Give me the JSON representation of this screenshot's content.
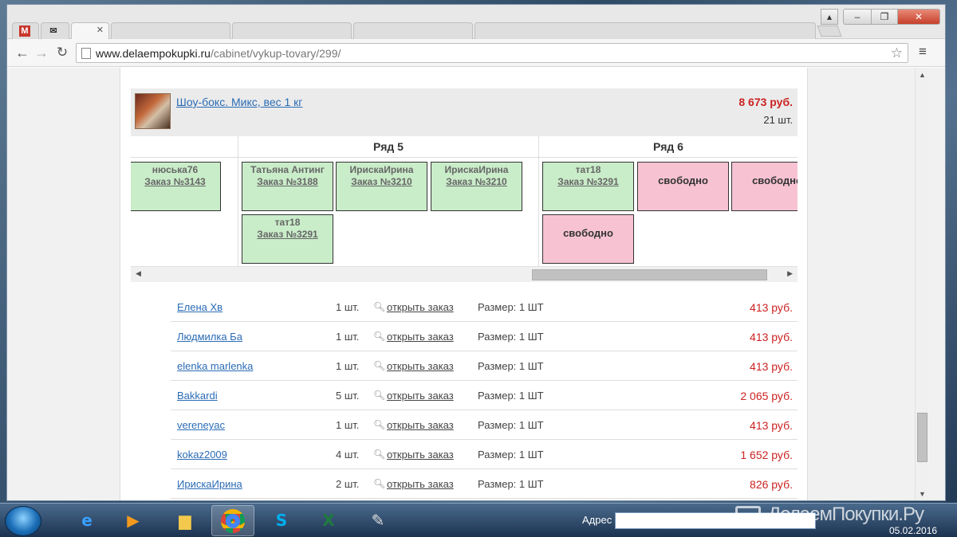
{
  "browser": {
    "tabs": [
      {
        "icon": "gmail-icon",
        "icon_text": "M"
      },
      {
        "icon": "mail-icon",
        "icon_text": "✉"
      },
      {
        "close": "✕"
      }
    ],
    "url_host": "www.delaempokupki.ru",
    "url_path": "/cabinet/vykup-tovary/299/"
  },
  "product": {
    "name": "Шоу-бокс. Микс, вес 1 кг",
    "price": "8 673 руб.",
    "qty": "21 шт."
  },
  "grid": {
    "rows": [
      {
        "title": "Ряд 5"
      },
      {
        "title": "Ряд 6"
      }
    ],
    "cells": [
      {
        "name": "нюська76",
        "order": "Заказ №3143",
        "status": "green"
      },
      {
        "name": "Татьяна Антинг",
        "order": "Заказ №3188",
        "status": "green"
      },
      {
        "name": "ИрискаИрина",
        "order": "Заказ №3210",
        "status": "green"
      },
      {
        "name": "ИрискаИрина",
        "order": "Заказ №3210",
        "status": "green"
      },
      {
        "name": "тат18",
        "order": "Заказ №3291",
        "status": "green"
      },
      {
        "label": "свободно",
        "status": "pink"
      },
      {
        "label": "свободно",
        "status": "pink"
      },
      {
        "name": "тат18",
        "order": "Заказ №3291",
        "status": "green"
      },
      {
        "label": "свободно",
        "status": "pink"
      }
    ]
  },
  "orders": [
    {
      "name": "Елена Хв",
      "qty": "1 шт.",
      "link": "открыть заказ",
      "size": "Размер: 1 ШТ",
      "price": "413 руб."
    },
    {
      "name": "Людмилка Ба",
      "qty": "1 шт.",
      "link": "открыть заказ",
      "size": "Размер: 1 ШТ",
      "price": "413 руб."
    },
    {
      "name": "elenka marlenka",
      "qty": "1 шт.",
      "link": "открыть заказ",
      "size": "Размер: 1 ШТ",
      "price": "413 руб."
    },
    {
      "name": "Bakkardi",
      "qty": "5 шт.",
      "link": "открыть заказ",
      "size": "Размер: 1 ШТ",
      "price": "2 065 руб."
    },
    {
      "name": "vereneyac",
      "qty": "1 шт.",
      "link": "открыть заказ",
      "size": "Размер: 1 ШТ",
      "price": "413 руб."
    },
    {
      "name": "kokaz2009",
      "qty": "4 шт.",
      "link": "открыть заказ",
      "size": "Размер: 1 ШТ",
      "price": "1 652 руб."
    },
    {
      "name": "ИрискаИрина",
      "qty": "2 шт.",
      "link": "открыть заказ",
      "size": "Размер: 1 ШТ",
      "price": "826 руб."
    }
  ],
  "taskbar": {
    "address_label": "Адрес",
    "brand": "ДелаемПокупки.Ру",
    "date": "05.02.2016",
    "apps": [
      "internet-explorer",
      "media-player",
      "file-explorer",
      "chrome",
      "skype",
      "excel",
      "paint"
    ]
  },
  "colors": {
    "price": "#cc2222",
    "link": "#2b6cb5",
    "cell_green": "#c9ecc9",
    "cell_pink": "#f7c3d3"
  }
}
